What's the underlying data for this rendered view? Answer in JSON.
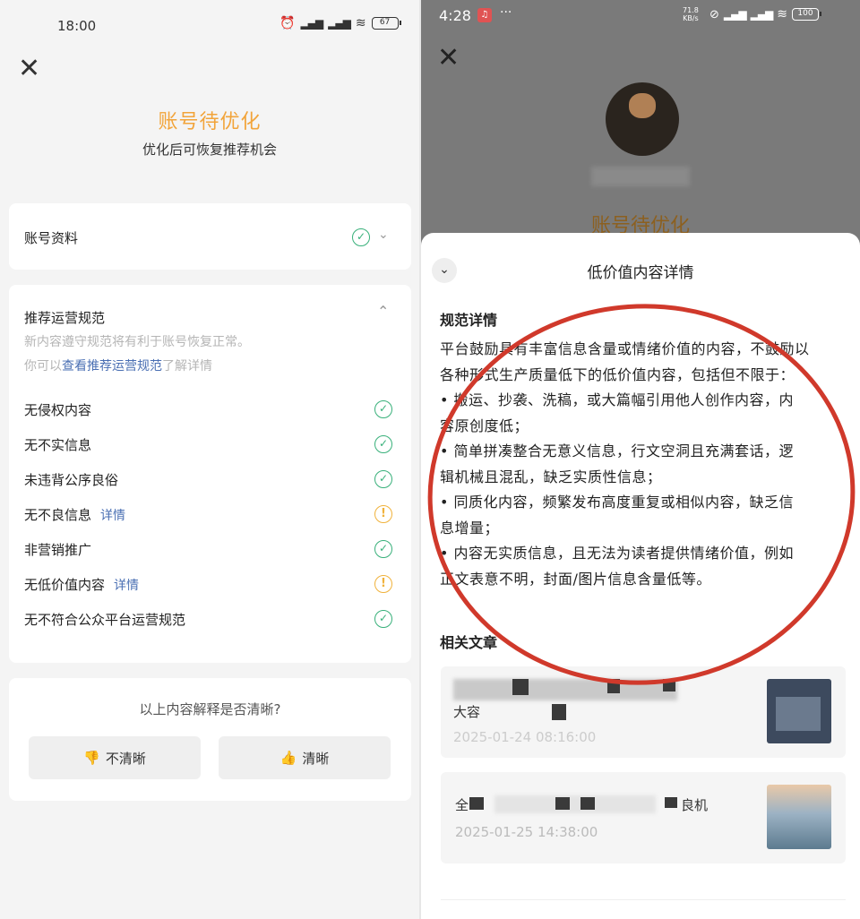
{
  "left": {
    "status_time": "18:00",
    "battery": "67",
    "title": "账号待优化",
    "subtitle": "优化后可恢复推荐机会",
    "account_label": "账号资料",
    "rules_title": "推荐运营规范",
    "rules_desc1": "新内容遵守规范将有利于账号恢复正常。",
    "rules_desc2_prefix": "你可以",
    "rules_desc2_link": "查看推荐运营规范",
    "rules_desc2_suffix": "了解详情",
    "items": [
      {
        "label": "无侵权内容",
        "detail": "",
        "status": "ok"
      },
      {
        "label": "无不实信息",
        "detail": "",
        "status": "ok"
      },
      {
        "label": "未违背公序良俗",
        "detail": "",
        "status": "ok"
      },
      {
        "label": "无不良信息",
        "detail": "详情",
        "status": "warn"
      },
      {
        "label": "非营销推广",
        "detail": "",
        "status": "ok"
      },
      {
        "label": "无低价值内容",
        "detail": "详情",
        "status": "warn"
      },
      {
        "label": "无不符合公众平台运营规范",
        "detail": "",
        "status": "ok"
      }
    ],
    "feedback_question": "以上内容解释是否清晰?",
    "unclear_label": "不清晰",
    "clear_label": "清晰"
  },
  "right": {
    "status_time": "4:28",
    "net_speed": "71.8",
    "net_unit": "KB/s",
    "battery": "100",
    "bg_title": "账号待优化",
    "sheet_title": "低价值内容详情",
    "section_title": "规范详情",
    "lines": [
      "平台鼓励具有丰富信息含量或情绪价值的内容，不鼓励以",
      "各种形式生产质量低下的低价值内容，包括但不限于：",
      "• 搬运、抄袭、洗稿，或大篇幅引用他人创作内容，内",
      "容原创度低；",
      "• 简单拼凑整合无意义信息，行文空洞且充满套话，逻",
      "辑机械且混乱，缺乏实质性信息；",
      "• 同质化内容，频繁发布高度重复或相似内容，缺乏信",
      "息增量；",
      "• 内容无实质信息，且无法为读者提供情绪价值，例如",
      "正文表意不明，封面/图片信息含量低等。"
    ],
    "related_title": "相关文章",
    "article1_text": "大容",
    "article1_date": "2025-01-24 08:16:00",
    "article2_text_a": "全",
    "article2_text_b": "良机",
    "article2_date": "2025-01-25 14:38:00"
  },
  "colors": {
    "accent": "#f2a43a",
    "ok": "#38b07a",
    "warn": "#f0b23c",
    "link": "#4a6fb3",
    "annotation": "#d0392b"
  }
}
